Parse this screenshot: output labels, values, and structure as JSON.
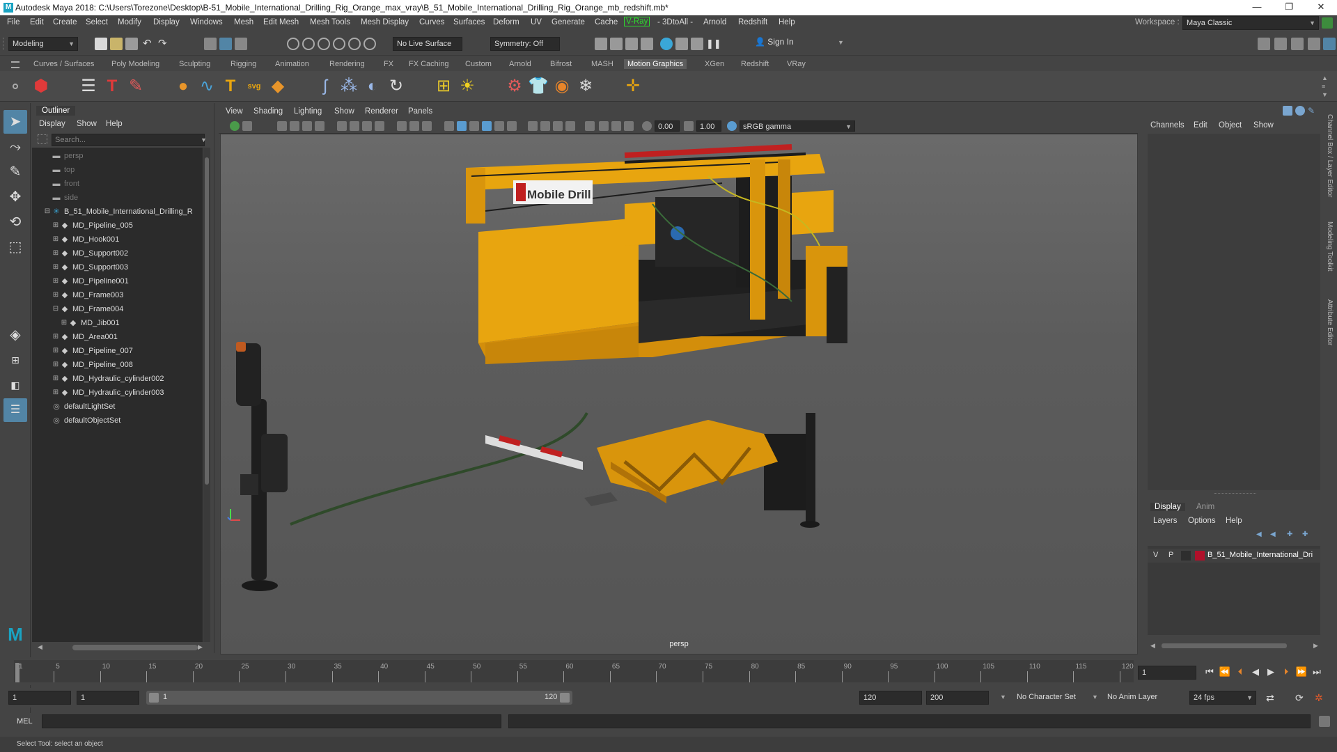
{
  "window": {
    "title": "Autodesk Maya 2018: C:\\Users\\Torezone\\Desktop\\B-51_Mobile_International_Drilling_Rig_Orange_max_vray\\B_51_Mobile_International_Drilling_Rig_Orange_mb_redshift.mb*",
    "controls": [
      "—",
      "❐",
      "✕"
    ]
  },
  "menubar": {
    "items": [
      "File",
      "Edit",
      "Create",
      "Select",
      "Modify",
      "Display",
      "Windows",
      "Mesh",
      "Edit Mesh",
      "Mesh Tools",
      "Mesh Display",
      "Curves",
      "Surfaces",
      "Deform",
      "UV",
      "Generate",
      "Cache",
      "V-Ray",
      "- 3DtoAll -",
      "Arnold",
      "Redshift",
      "Help"
    ],
    "workspace_label": "Workspace :",
    "workspace_value": "Maya Classic"
  },
  "statusline": {
    "mode": "Modeling",
    "live_surface": "No Live Surface",
    "symmetry": "Symmetry: Off",
    "sign_in": "Sign In"
  },
  "shelf": {
    "tabs": [
      "Curves / Surfaces",
      "Poly Modeling",
      "Sculpting",
      "Rigging",
      "Animation",
      "Rendering",
      "FX",
      "FX Caching",
      "Custom",
      "Arnold",
      "Bifrost",
      "MASH",
      "Motion Graphics",
      "XGen",
      "Redshift",
      "VRay"
    ],
    "active_tab": "Motion Graphics",
    "icons": [
      "cube-icon",
      "list-icon",
      "text-icon",
      "paint-icon",
      "sphere-icon",
      "curve-icon",
      "text-tool-icon",
      "svg-icon",
      "box-icon",
      "tentacle-icon",
      "scatter-icon",
      "shape-icon",
      "loop-icon",
      "grid-icon",
      "sun-icon",
      "gear-icon",
      "shirt-icon",
      "dynamics-icon",
      "snowflake-icon",
      "locator-icon"
    ]
  },
  "outliner": {
    "title": "Outliner",
    "menu": [
      "Display",
      "Show",
      "Help"
    ],
    "search_placeholder": "Search...",
    "rows": [
      {
        "label": "persp",
        "depth": 0,
        "icon": "camera-icon",
        "dim": true
      },
      {
        "label": "top",
        "depth": 0,
        "icon": "camera-icon",
        "dim": true
      },
      {
        "label": "front",
        "depth": 0,
        "icon": "camera-icon",
        "dim": true
      },
      {
        "label": "side",
        "depth": 0,
        "icon": "camera-icon",
        "dim": true
      },
      {
        "label": "B_51_Mobile_International_Drilling_R",
        "depth": 0,
        "icon": "group-icon",
        "exp": "minus"
      },
      {
        "label": "MD_Pipeline_005",
        "depth": 1,
        "icon": "mesh-icon",
        "exp": "plus"
      },
      {
        "label": "MD_Hook001",
        "depth": 1,
        "icon": "mesh-icon",
        "exp": "plus"
      },
      {
        "label": "MD_Support002",
        "depth": 1,
        "icon": "mesh-icon",
        "exp": "plus"
      },
      {
        "label": "MD_Support003",
        "depth": 1,
        "icon": "mesh-icon",
        "exp": "plus"
      },
      {
        "label": "MD_Pipeline001",
        "depth": 1,
        "icon": "mesh-icon",
        "exp": "plus"
      },
      {
        "label": "MD_Frame003",
        "depth": 1,
        "icon": "mesh-icon",
        "exp": "plus"
      },
      {
        "label": "MD_Frame004",
        "depth": 1,
        "icon": "mesh-icon",
        "exp": "minus"
      },
      {
        "label": "MD_Jib001",
        "depth": 2,
        "icon": "mesh-icon",
        "exp": "plus"
      },
      {
        "label": "MD_Area001",
        "depth": 1,
        "icon": "mesh-icon",
        "exp": "plus"
      },
      {
        "label": "MD_Pipeline_007",
        "depth": 1,
        "icon": "mesh-icon",
        "exp": "plus"
      },
      {
        "label": "MD_Pipeline_008",
        "depth": 1,
        "icon": "mesh-icon",
        "exp": "plus"
      },
      {
        "label": "MD_Hydraulic_cylinder002",
        "depth": 1,
        "icon": "mesh-icon",
        "exp": "plus"
      },
      {
        "label": "MD_Hydraulic_cylinder003",
        "depth": 1,
        "icon": "mesh-icon",
        "exp": "plus"
      },
      {
        "label": "defaultLightSet",
        "depth": 0,
        "icon": "set-icon"
      },
      {
        "label": "defaultObjectSet",
        "depth": 0,
        "icon": "set-icon"
      }
    ]
  },
  "viewport": {
    "menu": [
      "View",
      "Shading",
      "Lighting",
      "Show",
      "Renderer",
      "Panels"
    ],
    "exposure": "0.00",
    "gamma": "1.00",
    "color_space": "sRGB gamma",
    "camera_label": "persp",
    "logo_text": "Mobile Drill"
  },
  "channelbox": {
    "menu": [
      "Channels",
      "Edit",
      "Object",
      "Show"
    ],
    "tabs": [
      "Display",
      "Anim"
    ],
    "active_tab": "Display",
    "layer_menu": [
      "Layers",
      "Options",
      "Help"
    ],
    "layer": {
      "v": "V",
      "p": "P",
      "name": "B_51_Mobile_International_Dri",
      "color": "#b0102a"
    },
    "side_tabs": [
      "Channel Box / Layer Editor",
      "Modeling Toolkit",
      "Attribute Editor"
    ]
  },
  "timeslider": {
    "ticks": [
      "1",
      "5",
      "10",
      "15",
      "20",
      "25",
      "30",
      "35",
      "40",
      "45",
      "50",
      "55",
      "60",
      "65",
      "70",
      "75",
      "80",
      "85",
      "90",
      "95",
      "100",
      "105",
      "110",
      "115",
      "120"
    ],
    "current_frame": "1"
  },
  "range": {
    "start": "1",
    "inner_start": "1",
    "slider_start": "1",
    "slider_end": "120",
    "end": "120",
    "outer_end": "200",
    "character_set": "No Character Set",
    "anim_layer": "No Anim Layer",
    "fps": "24 fps"
  },
  "cmdline": {
    "label": "MEL"
  },
  "helpline": {
    "text": "Select Tool: select an object"
  },
  "colors": {
    "accent": "#5285a6",
    "rig_yellow": "#e8a50f",
    "vray_green": "#2ddc2d"
  }
}
